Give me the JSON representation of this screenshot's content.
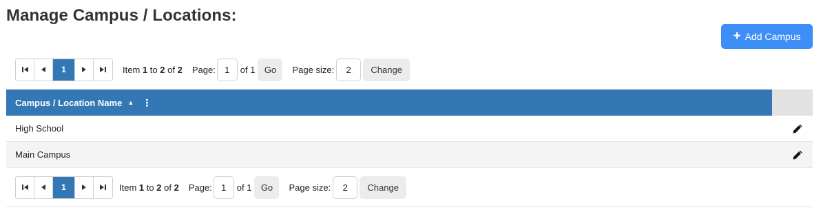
{
  "page": {
    "title": "Manage Campus / Locations:",
    "add_button_label": "Add Campus",
    "add_button_icon": "plus-icon"
  },
  "pager": {
    "current_page": "1",
    "item_prefix": "Item",
    "item_from": "1",
    "item_to_word": "to",
    "item_to": "2",
    "item_of_word": "of",
    "item_total": "2",
    "page_label": "Page:",
    "page_value": "1",
    "of_pages": "of 1",
    "go_label": "Go",
    "page_size_label": "Page size:",
    "page_size_value": "2",
    "change_label": "Change"
  },
  "grid": {
    "column_header": "Campus / Location Name",
    "sort": "ascending",
    "rows": [
      {
        "name": "High School"
      },
      {
        "name": "Main Campus"
      }
    ]
  },
  "colors": {
    "header_blue": "#3378b5",
    "add_button": "#3d8ef7"
  }
}
